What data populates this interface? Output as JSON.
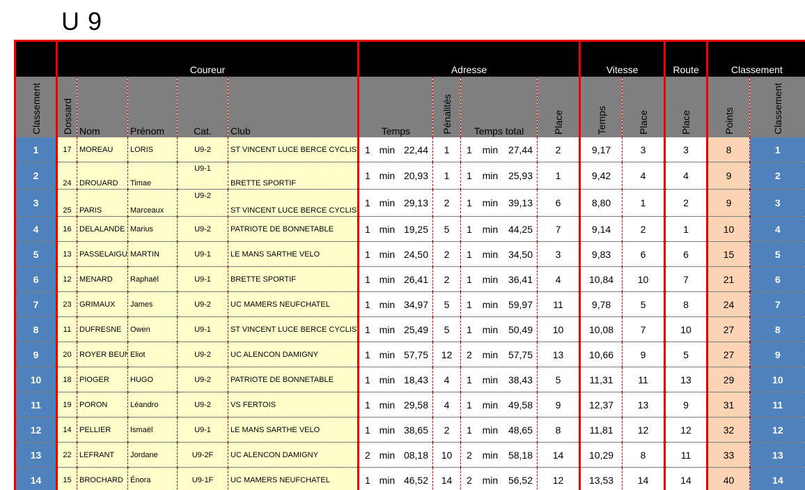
{
  "title": "U 9",
  "groups": {
    "coureur": "Coureur",
    "adresse": "Adresse",
    "vitesse": "Vitesse",
    "route": "Route",
    "classement": "Classement"
  },
  "headers": {
    "classement": "Classement",
    "dossard": "Dossard",
    "nom": "Nom",
    "prenom": "Prénom",
    "cat": "Cat.",
    "club": "Club",
    "temps": "Temps",
    "penalites": "Pénalités",
    "temps_total": "Temps total",
    "place_adresse": "Place",
    "temps_vitesse": "Temps",
    "place_vitesse": "Place",
    "place_route": "Place",
    "points": "Points",
    "classement_final": "Classement"
  },
  "time_units": {
    "min": "min"
  },
  "rows": [
    {
      "rank": "1",
      "dossard": "17",
      "nom": "MOREAU",
      "prenom": "LORIS",
      "cat": "U9-2",
      "club": "ST VINCENT LUCE BERCE CYCLISTE",
      "t_min": "1",
      "t_sec": "22,44",
      "pen": "1",
      "tt_min": "1",
      "tt_sec": "27,44",
      "place_a": "2",
      "v_temps": "9,17",
      "place_v": "3",
      "place_r": "3",
      "points": "8",
      "final": "1"
    },
    {
      "rank": "2",
      "dossard": "24",
      "nom": "DROUARD",
      "prenom": "Timae",
      "cat": "U9-1",
      "club": "BRETTE SPORTIF",
      "t_min": "1",
      "t_sec": "20,93",
      "pen": "1",
      "tt_min": "1",
      "tt_sec": "25,93",
      "place_a": "1",
      "v_temps": "9,42",
      "place_v": "4",
      "place_r": "4",
      "points": "9",
      "final": "2"
    },
    {
      "rank": "3",
      "dossard": "25",
      "nom": "PARIS",
      "prenom": "Marceaux",
      "cat": "U9-2",
      "club": "ST VINCENT LUCE BERCE CYCLISTE",
      "t_min": "1",
      "t_sec": "29,13",
      "pen": "2",
      "tt_min": "1",
      "tt_sec": "39,13",
      "place_a": "6",
      "v_temps": "8,80",
      "place_v": "1",
      "place_r": "2",
      "points": "9",
      "final": "3"
    },
    {
      "rank": "4",
      "dossard": "16",
      "nom": "DELALANDE",
      "prenom": "Marius",
      "cat": "U9-2",
      "club": "PATRIOTE DE BONNETABLE",
      "t_min": "1",
      "t_sec": "19,25",
      "pen": "5",
      "tt_min": "1",
      "tt_sec": "44,25",
      "place_a": "7",
      "v_temps": "9,14",
      "place_v": "2",
      "place_r": "1",
      "points": "10",
      "final": "4"
    },
    {
      "rank": "5",
      "dossard": "13",
      "nom": "PASSELAIGUE",
      "prenom": "MARTIN",
      "cat": "U9-1",
      "club": "LE MANS SARTHE VELO",
      "t_min": "1",
      "t_sec": "24,50",
      "pen": "2",
      "tt_min": "1",
      "tt_sec": "34,50",
      "place_a": "3",
      "v_temps": "9,83",
      "place_v": "6",
      "place_r": "6",
      "points": "15",
      "final": "5"
    },
    {
      "rank": "6",
      "dossard": "12",
      "nom": "MENARD",
      "prenom": "Raphaël",
      "cat": "U9-1",
      "club": "BRETTE SPORTIF",
      "t_min": "1",
      "t_sec": "26,41",
      "pen": "2",
      "tt_min": "1",
      "tt_sec": "36,41",
      "place_a": "4",
      "v_temps": "10,84",
      "place_v": "10",
      "place_r": "7",
      "points": "21",
      "final": "6"
    },
    {
      "rank": "7",
      "dossard": "23",
      "nom": "GRIMAUX",
      "prenom": "James",
      "cat": "U9-2",
      "club": "UC MAMERS NEUFCHATEL",
      "t_min": "1",
      "t_sec": "34,97",
      "pen": "5",
      "tt_min": "1",
      "tt_sec": "59,97",
      "place_a": "11",
      "v_temps": "9,78",
      "place_v": "5",
      "place_r": "8",
      "points": "24",
      "final": "7"
    },
    {
      "rank": "8",
      "dossard": "11",
      "nom": "DUFRESNE",
      "prenom": "Owen",
      "cat": "U9-1",
      "club": "ST VINCENT LUCE BERCE CYCLISTE",
      "t_min": "1",
      "t_sec": "25,49",
      "pen": "5",
      "tt_min": "1",
      "tt_sec": "50,49",
      "place_a": "10",
      "v_temps": "10,08",
      "place_v": "7",
      "place_r": "10",
      "points": "27",
      "final": "8"
    },
    {
      "rank": "9",
      "dossard": "20",
      "nom": "ROYER BEUNE",
      "prenom": "Eliot",
      "cat": "U9-2",
      "club": "UC ALENCON DAMIGNY",
      "t_min": "1",
      "t_sec": "57,75",
      "pen": "12",
      "tt_min": "2",
      "tt_sec": "57,75",
      "place_a": "13",
      "v_temps": "10,66",
      "place_v": "9",
      "place_r": "5",
      "points": "27",
      "final": "9"
    },
    {
      "rank": "10",
      "dossard": "18",
      "nom": "PIOGER",
      "prenom": "HUGO",
      "cat": "U9-2",
      "club": "PATRIOTE DE BONNETABLE",
      "t_min": "1",
      "t_sec": "18,43",
      "pen": "4",
      "tt_min": "1",
      "tt_sec": "38,43",
      "place_a": "5",
      "v_temps": "11,31",
      "place_v": "11",
      "place_r": "13",
      "points": "29",
      "final": "10"
    },
    {
      "rank": "11",
      "dossard": "19",
      "nom": "PORON",
      "prenom": "Léandro",
      "cat": "U9-2",
      "club": "VS FERTOIS",
      "t_min": "1",
      "t_sec": "29,58",
      "pen": "4",
      "tt_min": "1",
      "tt_sec": "49,58",
      "place_a": "9",
      "v_temps": "12,37",
      "place_v": "13",
      "place_r": "9",
      "points": "31",
      "final": "11"
    },
    {
      "rank": "12",
      "dossard": "14",
      "nom": "PELLIER",
      "prenom": "Ismaël",
      "cat": "U9-1",
      "club": "LE MANS SARTHE VELO",
      "t_min": "1",
      "t_sec": "38,65",
      "pen": "2",
      "tt_min": "1",
      "tt_sec": "48,65",
      "place_a": "8",
      "v_temps": "11,81",
      "place_v": "12",
      "place_r": "12",
      "points": "32",
      "final": "12"
    },
    {
      "rank": "13",
      "dossard": "22",
      "nom": "LEFRANT",
      "prenom": "Jordane",
      "cat": "U9-2F",
      "club": "UC ALENCON DAMIGNY",
      "t_min": "2",
      "t_sec": "08,18",
      "pen": "10",
      "tt_min": "2",
      "tt_sec": "58,18",
      "place_a": "14",
      "v_temps": "10,29",
      "place_v": "8",
      "place_r": "11",
      "points": "33",
      "final": "13"
    },
    {
      "rank": "14",
      "dossard": "15",
      "nom": "BROCHARD",
      "prenom": "Énora",
      "cat": "U9-1F",
      "club": "UC MAMERS NEUFCHATEL",
      "t_min": "1",
      "t_sec": "46,52",
      "pen": "14",
      "tt_min": "2",
      "tt_sec": "56,52",
      "place_a": "12",
      "v_temps": "13,53",
      "place_v": "14",
      "place_r": "14",
      "points": "40",
      "final": "14"
    }
  ]
}
